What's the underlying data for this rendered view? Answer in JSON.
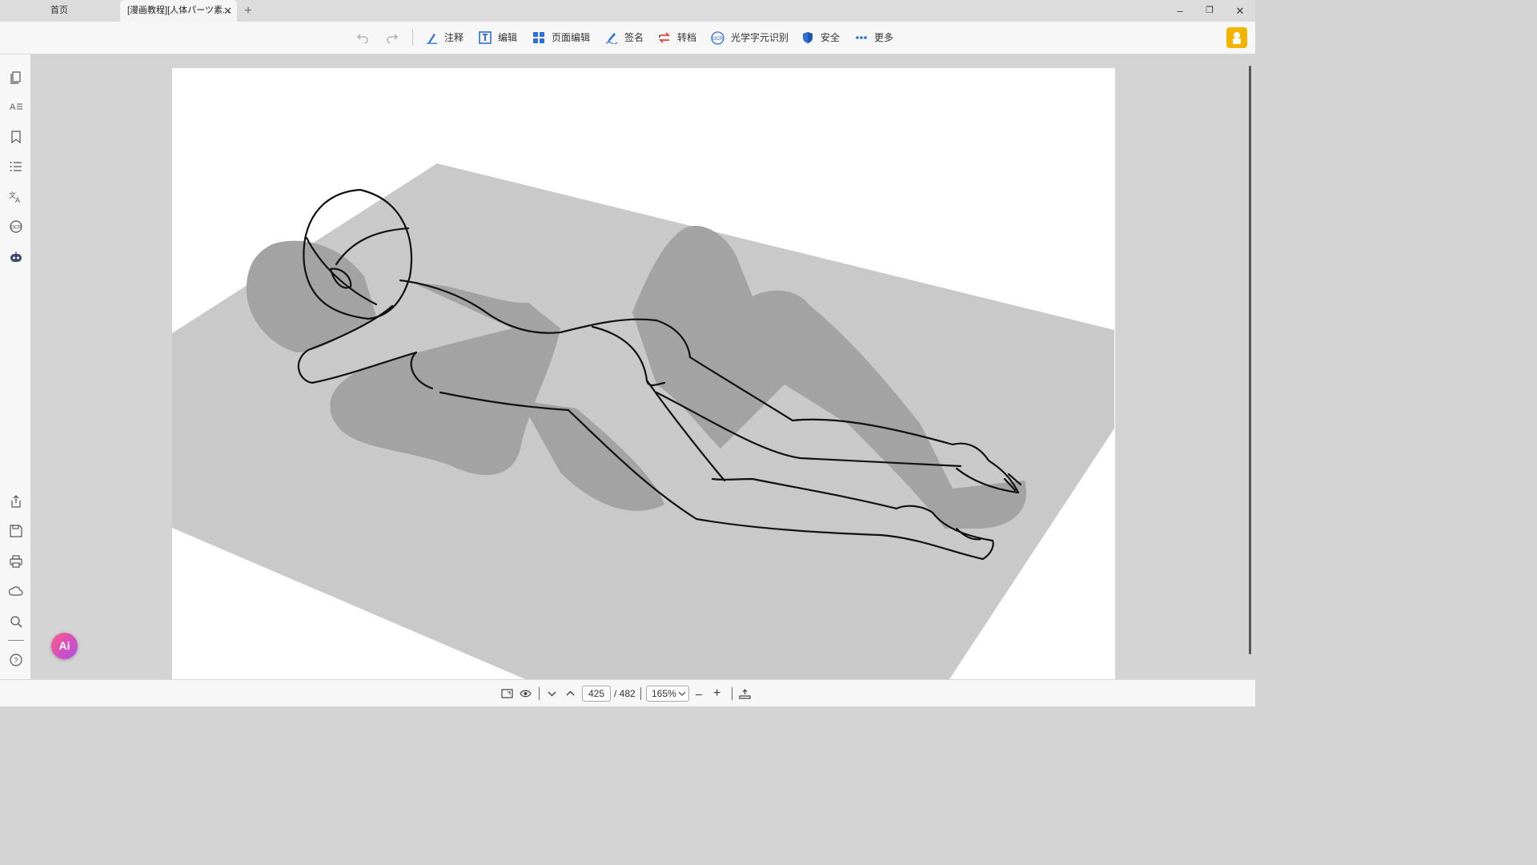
{
  "tabs": {
    "home_label": "首页",
    "doc_label": "[漫画教程][人体パーツ素...",
    "close_glyph": "✕",
    "new_glyph": "+"
  },
  "window": {
    "minimize": "–",
    "restore": "❐",
    "close": "✕"
  },
  "toolbar": {
    "undo_icon": "undo-icon",
    "redo_icon": "redo-icon",
    "annotate": "注释",
    "edit": "编辑",
    "page_edit": "页面编辑",
    "sign": "签名",
    "convert": "转档",
    "ocr": "光学字元识别",
    "security": "安全",
    "more": "更多"
  },
  "sidebar": {
    "items": [
      "pages-icon",
      "text-icon",
      "bookmark-icon",
      "outline-icon",
      "translate-icon",
      "ocr-icon",
      "robot-icon",
      "share-icon",
      "save-icon",
      "print-icon",
      "cloud-icon",
      "search-icon",
      "help-icon"
    ],
    "ai_label": "Ai"
  },
  "status": {
    "current_page": "425",
    "total_pages": "/ 482",
    "zoom": "165%",
    "zoom_out": "–",
    "zoom_in": "+"
  },
  "colors": {
    "accent_blue": "#2e6fd8",
    "user_badge": "#f3b400",
    "floor_gray": "#c9c9c9",
    "shadow_gray": "#a3a3a3"
  }
}
